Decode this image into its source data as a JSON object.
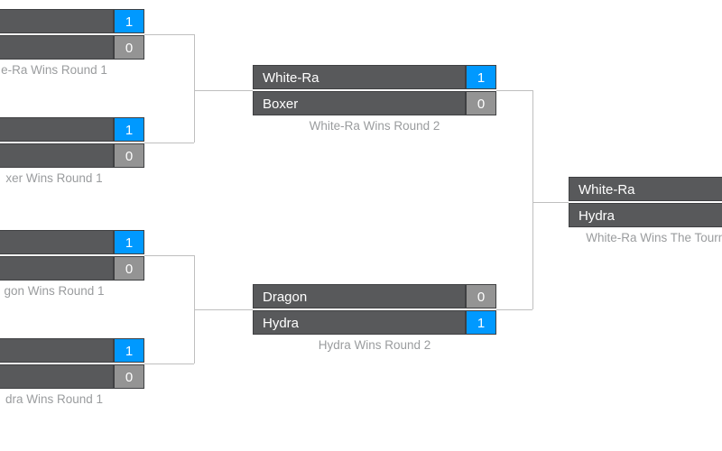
{
  "round1": {
    "m1": {
      "top_name": "",
      "top_score": "1",
      "bot_name": "",
      "bot_score": "0",
      "caption": "e-Ra Wins Round 1"
    },
    "m2": {
      "top_name": "",
      "top_score": "1",
      "bot_name": "",
      "bot_score": "0",
      "caption": "xer Wins Round 1"
    },
    "m3": {
      "top_name": "",
      "top_score": "1",
      "bot_name": "",
      "bot_score": "0",
      "caption": "gon Wins Round 1"
    },
    "m4": {
      "top_name": "",
      "top_score": "1",
      "bot_name": "",
      "bot_score": "0",
      "caption": "dra Wins Round 1"
    }
  },
  "round2": {
    "m1": {
      "top_name": "White-Ra",
      "top_score": "1",
      "bot_name": "Boxer",
      "bot_score": "0",
      "caption": "White-Ra Wins Round 2"
    },
    "m2": {
      "top_name": "Dragon",
      "top_score": "0",
      "bot_name": "Hydra",
      "bot_score": "1",
      "caption": "Hydra Wins Round 2"
    }
  },
  "final": {
    "top_name": "White-Ra",
    "bot_name": "Hydra",
    "caption": "White-Ra Wins The Tournament"
  }
}
